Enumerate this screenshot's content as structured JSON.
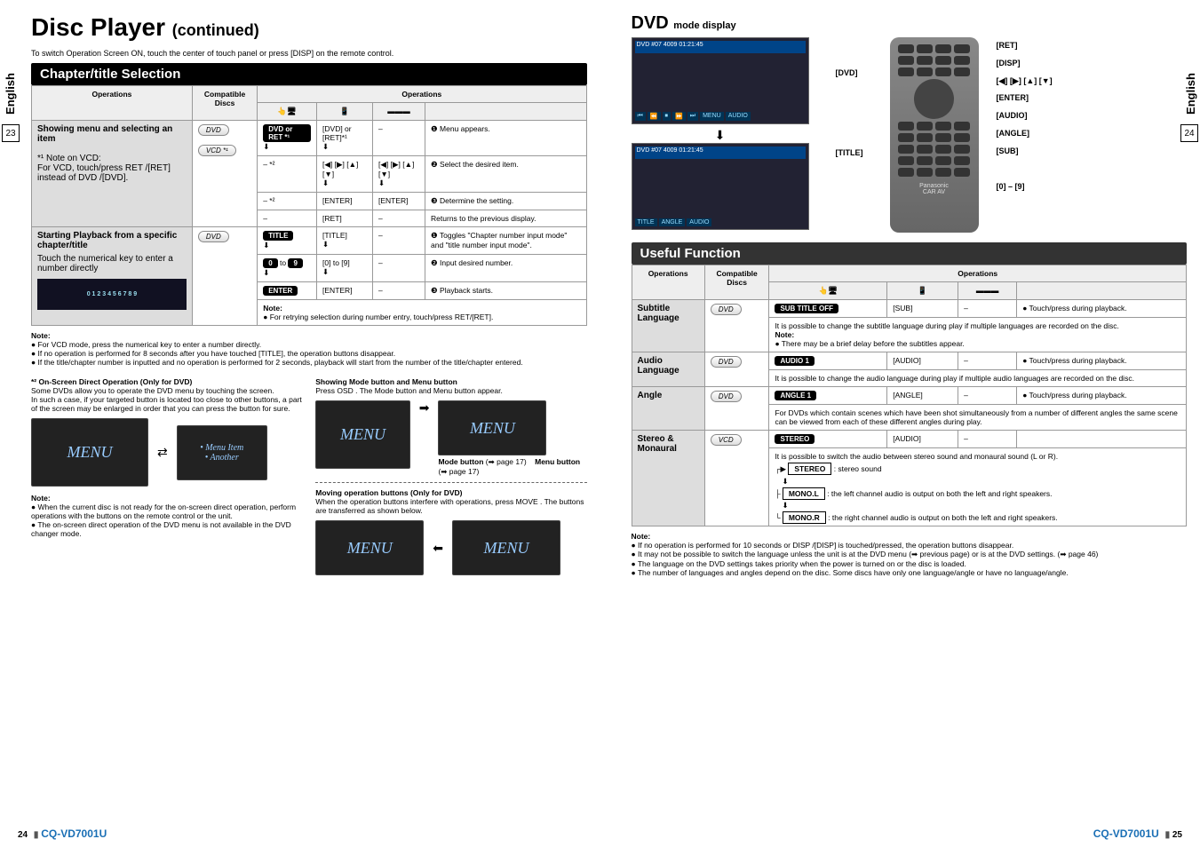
{
  "language_tab": "English",
  "side_page_left": "23",
  "side_page_right": "24",
  "title_main": "Disc Player",
  "title_cont": "(continued)",
  "switch_note": "To switch Operation Screen ON, touch the center of touch panel or press [DISP] on the remote control.",
  "section_chapter": "Chapter/title Selection",
  "table1": {
    "head_operations": "Operations",
    "head_compat": "Compatible Discs",
    "head_ops_group": "Operations",
    "row1": {
      "label": "Showing menu and selecting an item",
      "note_label": "*¹ Note on VCD:",
      "note_body": "For VCD, touch/press RET /[RET] instead of DVD /[DVD].",
      "discs": [
        "DVD",
        "VCD *¹"
      ],
      "touch1": "DVD or RET *¹",
      "rc1": "[DVD] or [RET]*¹",
      "desc1": "❶ Menu appears.",
      "touch2": "– *²",
      "rc2a": "[◀] [▶] [▲] [▼]",
      "rc2b": "[◀] [▶] [▲] [▼]",
      "desc2": "❷ Select the desired item.",
      "touch3": "– *²",
      "rc3a": "[ENTER]",
      "rc3b": "[ENTER]",
      "desc3": "❸ Determine the setting.",
      "retrow_rc": "[RET]",
      "retrow_desc": "Returns to the previous display."
    },
    "row2": {
      "label": "Starting Playback from a specific chapter/title",
      "sublabel": "Touch the numerical key to enter a number directly",
      "discs": [
        "DVD"
      ],
      "touch1": "TITLE",
      "rc1": "[TITLE]",
      "desc1": "❶ Toggles \"Chapter number input mode\" and \"title number input mode\".",
      "touch2": "0 to 9",
      "rc2": "[0] to [9]",
      "desc2": "❷ Input desired number.",
      "touch3": "ENTER",
      "rc3": "[ENTER]",
      "desc3": "❸ Playback starts.",
      "retry_note_hd": "Note:",
      "retry_note": "● For retrying selection during number entry, touch/press RET/[RET]."
    }
  },
  "note1": {
    "hd": "Note:",
    "items": [
      "● For VCD mode, press the numerical key to enter a number directly.",
      "● If no operation is performed for 8 seconds after you have touched [TITLE], the operation buttons disappear.",
      "● If the title/chapter number is inputted and no operation is performed for 2 seconds, playback will start from the number of the title/chapter entered."
    ]
  },
  "onscreen": {
    "hd": "*² On-Screen Direct Operation (Only for DVD)",
    "p1": "Some DVDs allow you to operate the DVD menu by touching the screen.",
    "p2": "In such a case, if your targeted button is located too close to other buttons, a part of the screen may be enlarged in order that you can press the button for sure.",
    "note_hd": "Note:",
    "note_items": [
      "● When the current disc is not ready for the on-screen direct operation, perform operations with the buttons on the remote control or the unit.",
      "● The on-screen direct operation of the DVD menu is not available in the DVD changer mode."
    ]
  },
  "modebtn": {
    "hd": "Showing Mode button and Menu button",
    "p": "Press OSD . The Mode button and Menu button appear.",
    "mode_label": "Mode button",
    "mode_ref": "(➡ page 17)",
    "menu_label": "Menu button",
    "menu_ref": "(➡ page 17)"
  },
  "moving": {
    "hd": "Moving operation buttons (Only for DVD)",
    "p1": "When the operation buttons interfere with operations, press MOVE . The buttons are transferred as shown below."
  },
  "menu_text": "MENU",
  "right": {
    "dvd_title": "DVD",
    "dvd_title_sub": "mode display",
    "screen_label_top": "DVD",
    "screen_bar": "#07 4009 01:21:45",
    "lbl_dvd": "[DVD]",
    "lbl_title": "[TITLE]",
    "remote_labels": {
      "ret": "[RET]",
      "disp": "[DISP]",
      "arrows": "[◀] [▶] [▲] [▼]",
      "enter": "[ENTER]",
      "audio": "[AUDIO]",
      "angle": "[ANGLE]",
      "sub": "[SUB]",
      "nums": "[0] – [9]"
    },
    "remote_brand1": "Panasonic",
    "remote_brand2": "CAR AV",
    "section_useful": "Useful Function",
    "table2": {
      "head_operations": "Operations",
      "head_compat": "Compatible Discs",
      "head_ops_group": "Operations",
      "subtitle": {
        "label": "Subtitle Language",
        "disc": "DVD",
        "touchbtn": "SUB TITLE OFF",
        "rc": "[SUB]",
        "desc": "● Touch/press during playback.",
        "body": "It is possible to change the subtitle language during play if multiple languages are recorded on the disc.",
        "note_hd": "Note:",
        "note": "● There may be a brief delay before the subtitles appear."
      },
      "audio": {
        "label": "Audio Language",
        "disc": "DVD",
        "touchbtn": "AUDIO 1",
        "rc": "[AUDIO]",
        "desc": "● Touch/press during playback.",
        "body": "It is possible to change the audio language during play if multiple audio languages are recorded on the disc."
      },
      "angle": {
        "label": "Angle",
        "disc": "DVD",
        "touchbtn": "ANGLE 1",
        "rc": "[ANGLE]",
        "desc": "● Touch/press during playback.",
        "body": "For DVDs which contain scenes which have been shot simultaneously from a number of different angles the same scene can be viewed from each of these different angles during play."
      },
      "stereo": {
        "label": "Stereo & Monaural",
        "disc": "VCD",
        "touchbtn": "STEREO",
        "rc": "[AUDIO]",
        "body": "It is possible to switch the audio between stereo sound and monaural sound (L or R).",
        "opt_stereo_name": "STEREO",
        "opt_stereo": ": stereo sound",
        "opt_monol_name": "MONO.L",
        "opt_monol": ": the left channel audio is output on both the left and right speakers.",
        "opt_monor_name": "MONO.R",
        "opt_monor": ": the right channel audio is output on both the left and right speakers."
      }
    },
    "note2": {
      "hd": "Note:",
      "items": [
        "● If no operation is performed for 10 seconds or DISP /[DISP] is touched/pressed, the operation buttons disappear.",
        "● It may not be possible to switch the language unless the unit is at the DVD menu (➡ previous page) or is at the DVD settings. (➡ page 46)",
        "● The language on the DVD settings takes priority when the power is turned on or the disc is loaded.",
        "● The number of languages and angles depend on the disc. Some discs have only one language/angle or have no language/angle."
      ]
    }
  },
  "footer_left_num": "24",
  "footer_right_num": "25",
  "footer_model": "CQ-VD7001U"
}
